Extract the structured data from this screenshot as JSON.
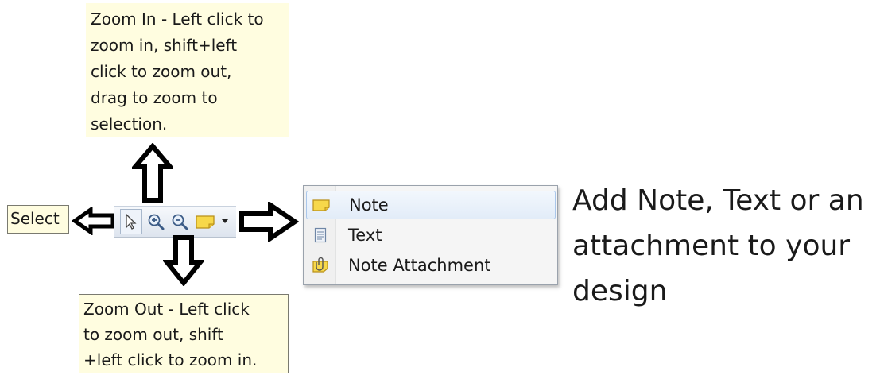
{
  "tooltips": {
    "zoom_in": [
      "Zoom In - Left click to",
      "zoom in, shift+left",
      "click to zoom out,",
      "drag to zoom to",
      "selection."
    ],
    "select": "Select",
    "zoom_out": [
      "Zoom Out - Left click",
      "to zoom out, shift",
      "+left click to zoom in."
    ]
  },
  "toolbar": {
    "buttons": [
      {
        "name": "select-tool",
        "icon": "cursor-arrow-icon"
      },
      {
        "name": "zoom-in-tool",
        "icon": "magnifier-plus-icon"
      },
      {
        "name": "zoom-out-tool",
        "icon": "magnifier-minus-icon"
      },
      {
        "name": "note-tool",
        "icon": "sticky-note-icon"
      },
      {
        "name": "note-dropdown",
        "icon": "dropdown-triangle-icon"
      }
    ]
  },
  "menu": {
    "items": [
      {
        "label": "Note",
        "icon": "sticky-note-icon",
        "selected": true
      },
      {
        "label": "Text",
        "icon": "text-document-icon",
        "selected": false
      },
      {
        "label": "Note Attachment",
        "icon": "paperclip-note-icon",
        "selected": false
      }
    ]
  },
  "callout": [
    "Add Note, Text or an",
    "attachment to your",
    "design"
  ],
  "colors": {
    "tooltip_bg": "#fffde0",
    "note_yellow": "#f7d84a",
    "selection_border": "#a9c6ea"
  }
}
